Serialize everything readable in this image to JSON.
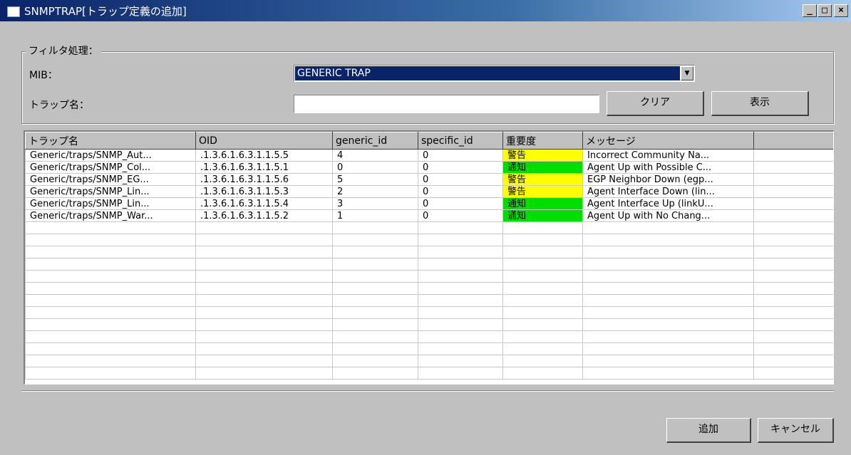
{
  "window": {
    "title": "SNMPTRAP[トラップ定義の追加]",
    "minimize_glyph": "_",
    "maximize_glyph": "□",
    "close_glyph": "×"
  },
  "filter": {
    "legend": "フィルタ処理：",
    "mib_label": "MIB：",
    "mib_value": "GENERIC TRAP",
    "trap_name_label": "トラップ名：",
    "trap_name_value": "",
    "clear_button": "クリア",
    "show_button": "表示"
  },
  "table": {
    "columns": [
      "トラップ名",
      "OID",
      "generic_id",
      "specific_id",
      "重要度",
      "メッセージ",
      ""
    ],
    "rows": [
      {
        "name": "Generic/traps/SNMP_Aut...",
        "oid": ".1.3.6.1.6.3.1.1.5.5",
        "generic_id": "4",
        "specific_id": "0",
        "severity": "警告",
        "message": "Incorrect Community Na..."
      },
      {
        "name": "Generic/traps/SNMP_Col...",
        "oid": ".1.3.6.1.6.3.1.1.5.1",
        "generic_id": "0",
        "specific_id": "0",
        "severity": "通知",
        "message": "Agent Up with Possible C..."
      },
      {
        "name": "Generic/traps/SNMP_EG...",
        "oid": ".1.3.6.1.6.3.1.1.5.6",
        "generic_id": "5",
        "specific_id": "0",
        "severity": "警告",
        "message": "EGP Neighbor Down (egp..."
      },
      {
        "name": "Generic/traps/SNMP_Lin...",
        "oid": ".1.3.6.1.6.3.1.1.5.3",
        "generic_id": "2",
        "specific_id": "0",
        "severity": "警告",
        "message": "Agent Interface Down (lin..."
      },
      {
        "name": "Generic/traps/SNMP_Lin...",
        "oid": ".1.3.6.1.6.3.1.1.5.4",
        "generic_id": "3",
        "specific_id": "0",
        "severity": "通知",
        "message": "Agent Interface Up (linkU..."
      },
      {
        "name": "Generic/traps/SNMP_War...",
        "oid": ".1.3.6.1.6.3.1.1.5.2",
        "generic_id": "1",
        "specific_id": "0",
        "severity": "通知",
        "message": "Agent Up with No Chang..."
      }
    ],
    "severity_colors": {
      "警告": "#ffff00",
      "通知": "#00dd00"
    }
  },
  "buttons": {
    "add": "追加",
    "cancel": "キャンセル"
  }
}
